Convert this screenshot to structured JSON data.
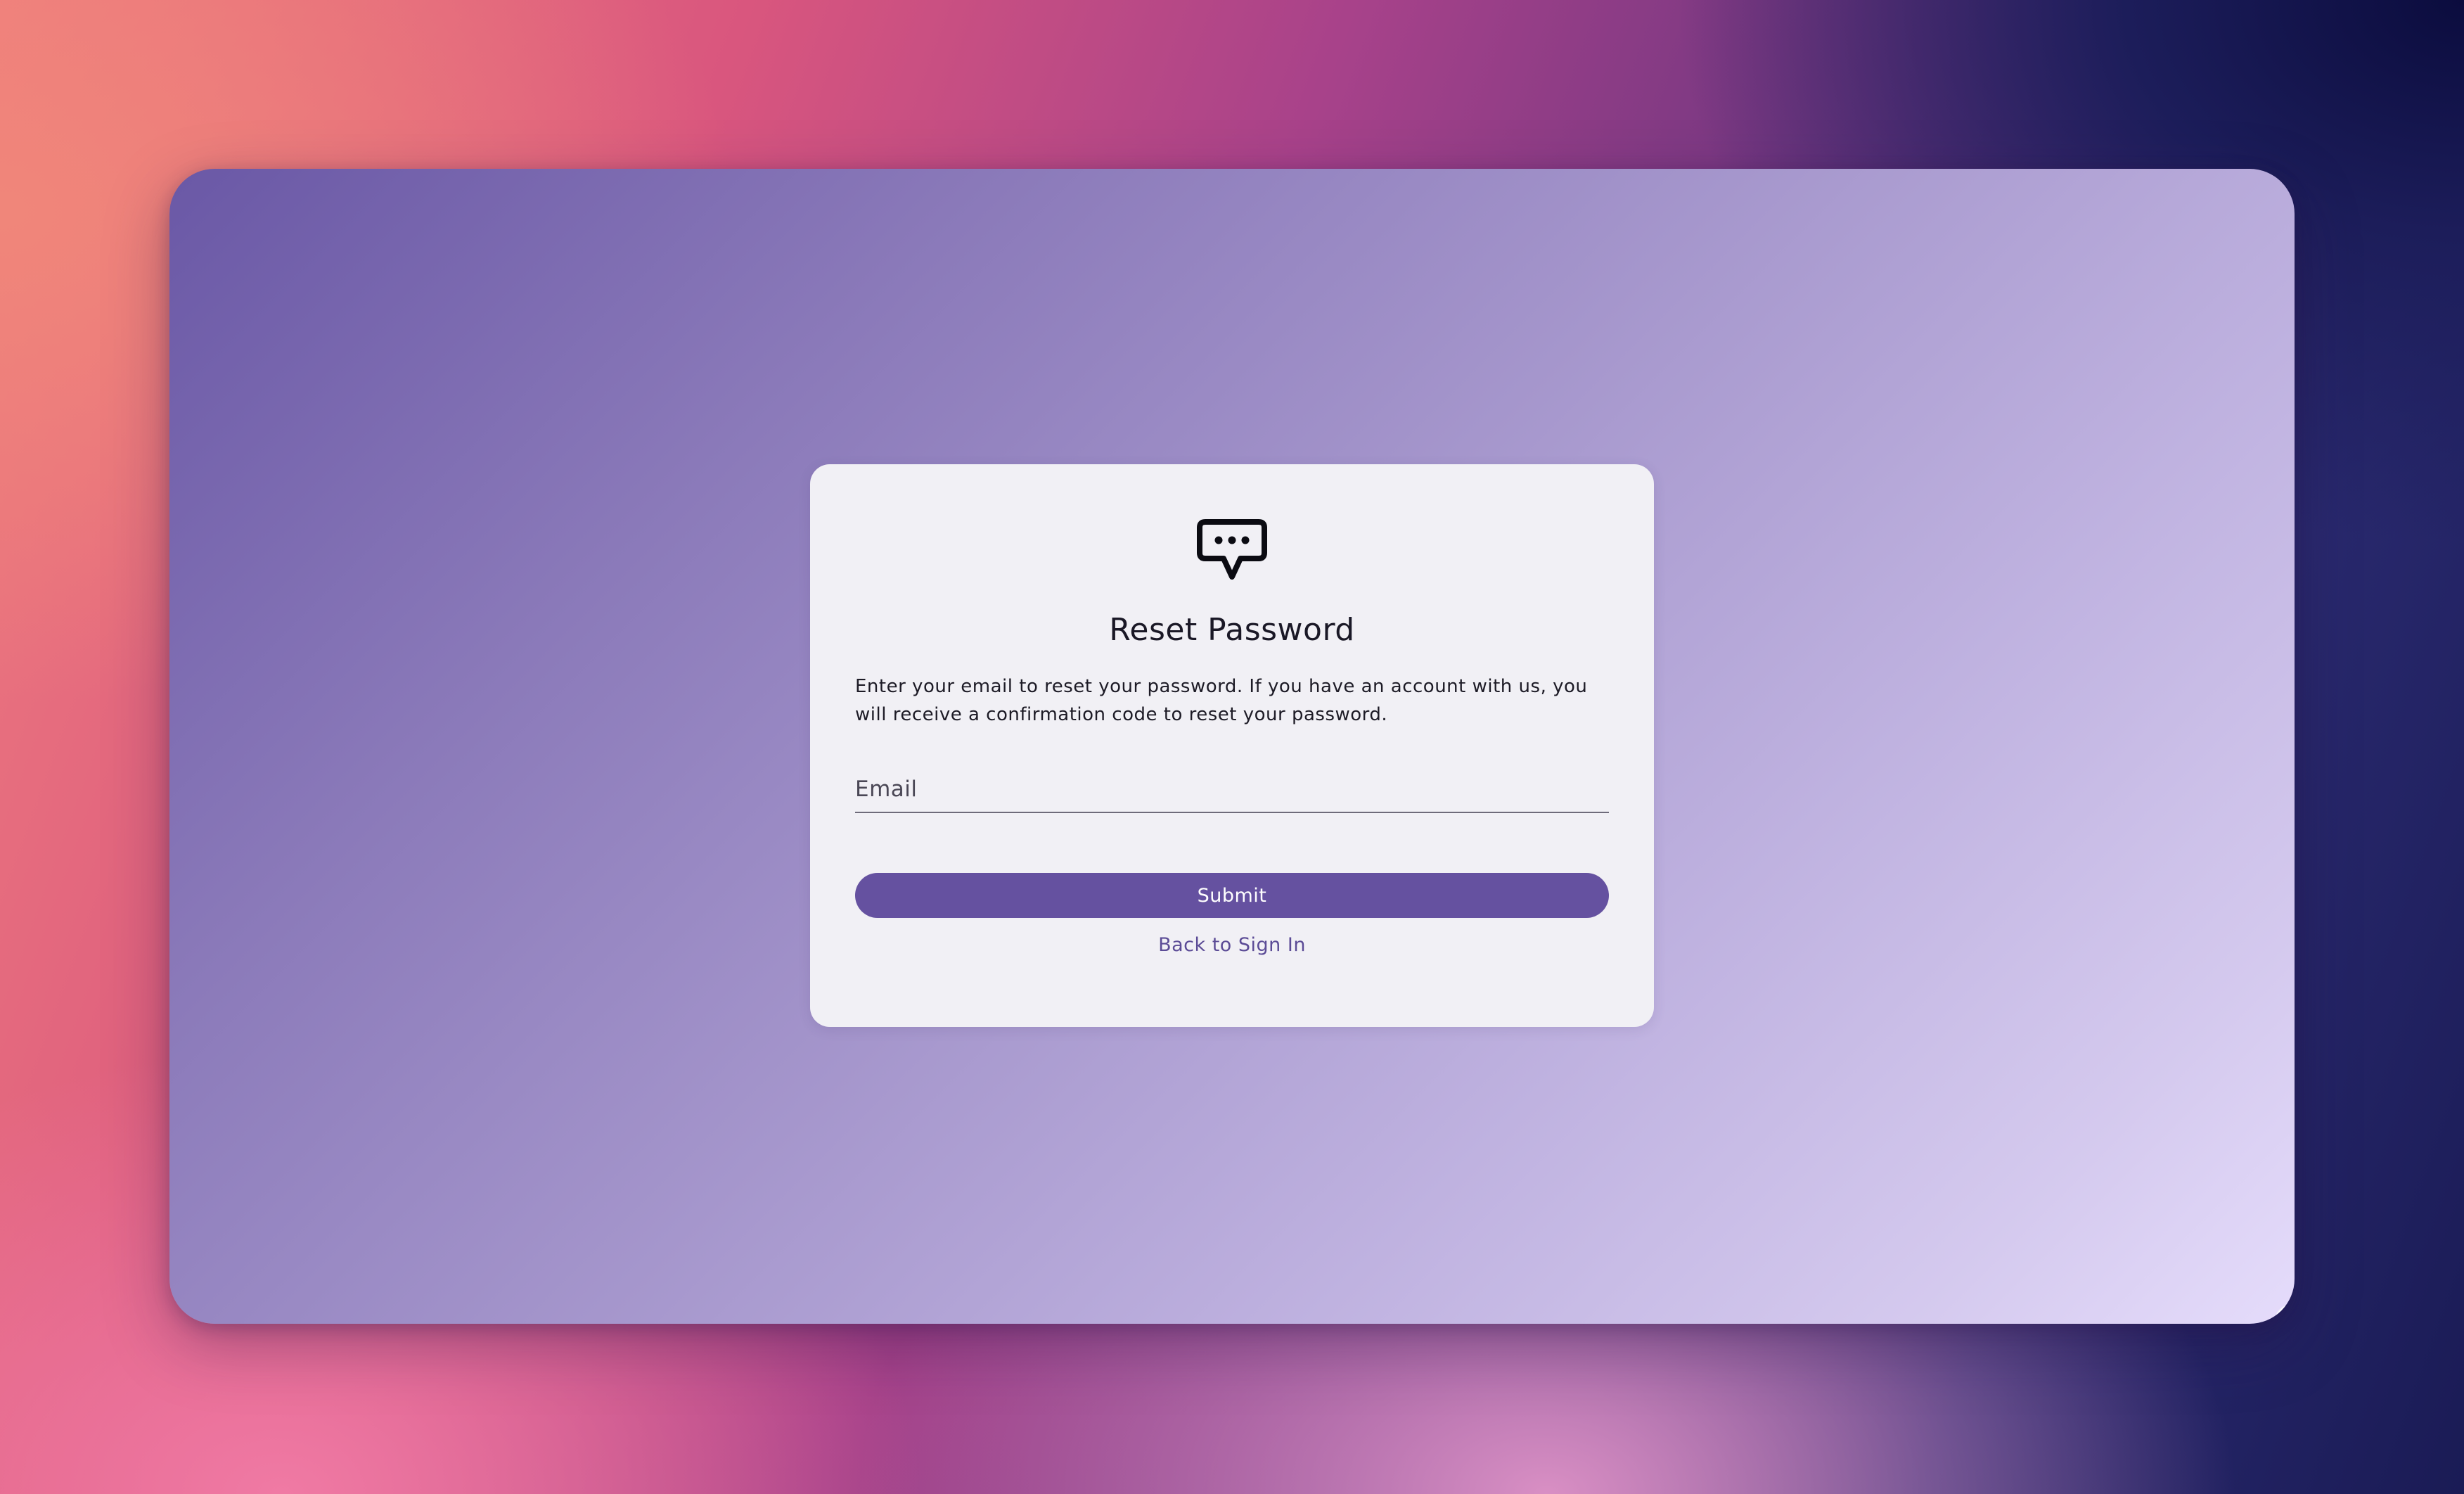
{
  "colors": {
    "accent": "#6551a0",
    "link": "#5b4b96",
    "card_background": "#f1f0f5",
    "text": "#1a1826"
  },
  "reset_form": {
    "logo_icon": "chat-bubble-icon",
    "title": "Reset Password",
    "description": "Enter your email to reset your password. If you have an account with us, you will receive a confirmation code to reset your password.",
    "email": {
      "placeholder": "Email",
      "value": ""
    },
    "submit_label": "Submit",
    "back_link_label": "Back to Sign In"
  }
}
